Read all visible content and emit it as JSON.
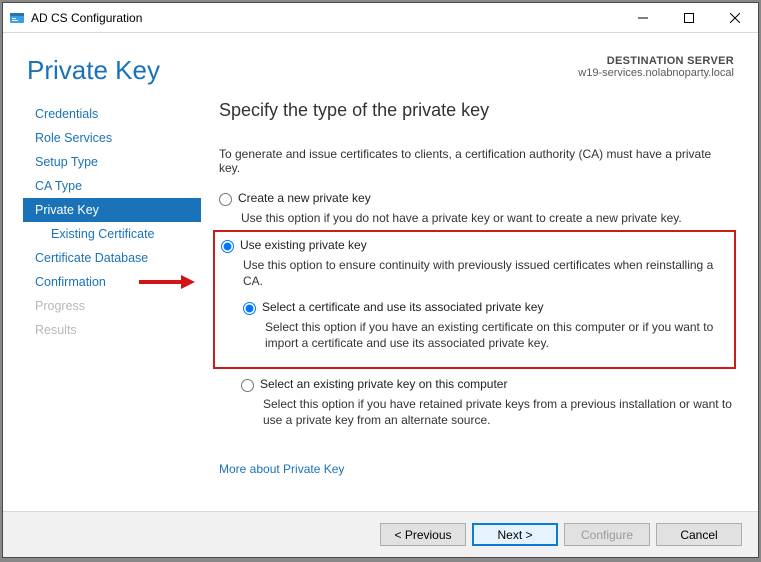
{
  "window": {
    "title": "AD CS Configuration"
  },
  "header": {
    "heading": "Private Key",
    "destination_label": "DESTINATION SERVER",
    "destination_server": "w19-services.nolabnoparty.local"
  },
  "sidebar": {
    "items": [
      {
        "label": "Credentials"
      },
      {
        "label": "Role Services"
      },
      {
        "label": "Setup Type"
      },
      {
        "label": "CA Type"
      },
      {
        "label": "Private Key"
      },
      {
        "label": "Existing Certificate"
      },
      {
        "label": "Certificate Database"
      },
      {
        "label": "Confirmation"
      },
      {
        "label": "Progress"
      },
      {
        "label": "Results"
      }
    ]
  },
  "content": {
    "title": "Specify the type of the private key",
    "intro": "To generate and issue certificates to clients, a certification authority (CA) must have a private key.",
    "opt_create": {
      "label": "Create a new private key",
      "desc": "Use this option if you do not have a private key or want to create a new private key."
    },
    "opt_existing": {
      "label": "Use existing private key",
      "desc": "Use this option to ensure continuity with previously issued certificates when reinstalling a CA.",
      "sub_select_cert": {
        "label": "Select a certificate and use its associated private key",
        "desc": "Select this option if you have an existing certificate on this computer or if you want to import a certificate and use its associated private key."
      },
      "sub_select_key": {
        "label": "Select an existing private key on this computer",
        "desc": "Select this option if you have retained private keys from a previous installation or want to use a private key from an alternate source."
      }
    },
    "more_link": "More about Private Key"
  },
  "footer": {
    "previous": "< Previous",
    "next": "Next >",
    "configure": "Configure",
    "cancel": "Cancel"
  }
}
